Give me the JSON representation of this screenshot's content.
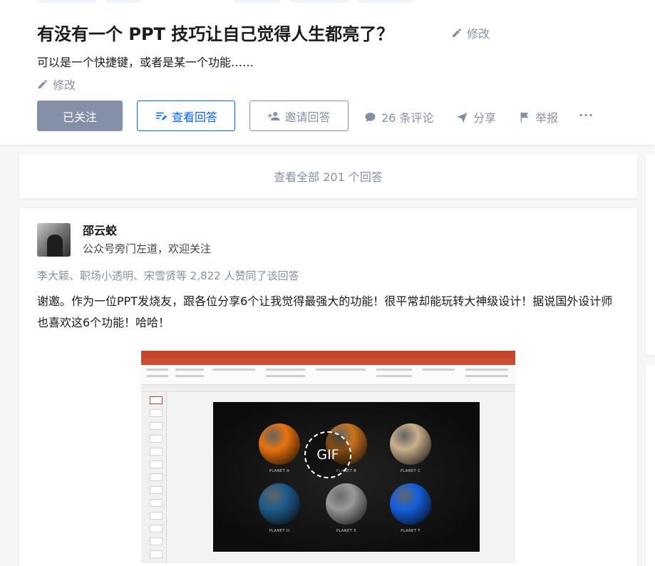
{
  "question": {
    "title": "有没有一个 PPT 技巧让自己觉得人生都亮了？",
    "title_edit_label": "修改",
    "detail": "可以是一个快捷键，或者是某一个功能……",
    "detail_edit_label": "修改"
  },
  "actions": {
    "followed_label": "已关注",
    "view_answers_label": "查看回答",
    "invite_label": "邀请回答",
    "comments_label": "26 条评论",
    "share_label": "分享",
    "report_label": "举报",
    "more_label": "···"
  },
  "view_all": {
    "label": "查看全部 201 个回答"
  },
  "answer": {
    "author_name": "邵云蛟",
    "author_bio": "公众号旁门左道，欢迎关注",
    "voters": "李大颖、职场小透明、宋雪贤等 2,822 人赞同了该回答",
    "content": "谢邀。作为一位PPT发烧友，跟各位分享6个让我觉得最强大的功能！很平常却能玩转大神级设计！据说国外设计师也喜欢这6个功能！哈哈！",
    "gif_badge": "GIF",
    "planets": [
      {
        "label": "PLANET A",
        "color": "#e8730f"
      },
      {
        "label": "PLANET B",
        "color": "#c9741e"
      },
      {
        "label": "PLANET C",
        "color": "#c9b08c"
      },
      {
        "label": "PLANET D",
        "color": "#1f5c8c"
      },
      {
        "label": "PLANET E",
        "color": "#9a9a9a"
      },
      {
        "label": "PLANET F",
        "color": "#1560e0"
      }
    ]
  },
  "colors": {
    "brand_blue": "#0066ff",
    "muted_gray": "#8590a6",
    "ppt_red": "#c4452a"
  }
}
